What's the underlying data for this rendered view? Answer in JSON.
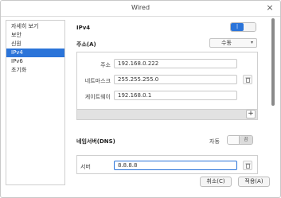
{
  "window": {
    "title": "Wired"
  },
  "sidebar": {
    "items": [
      {
        "label": "자세히 보기",
        "active": false
      },
      {
        "label": "보안",
        "active": false
      },
      {
        "label": "신원",
        "active": false
      },
      {
        "label": "IPv4",
        "active": true
      },
      {
        "label": "IPv6",
        "active": false
      },
      {
        "label": "초기화",
        "active": false
      }
    ]
  },
  "ipv4": {
    "heading": "IPv4",
    "toggle_on_symbol": "|",
    "address_section": {
      "label": "주소(A)",
      "method_value": "수동"
    },
    "fields": {
      "address_label": "주소",
      "address_value": "192.168.0.222",
      "netmask_label": "네트마스크",
      "netmask_value": "255.255.255.0",
      "gateway_label": "게이트웨이",
      "gateway_value": "192.168.0.1"
    },
    "add_symbol": "+",
    "dns": {
      "label": "네임서버(DNS)",
      "auto_label": "자동",
      "toggle_off_symbol": "끔",
      "server_label": "서버",
      "server_value": "8.8.8.8"
    }
  },
  "actions": {
    "cancel_label": "취소(C)",
    "apply_label": "적용(A)"
  }
}
